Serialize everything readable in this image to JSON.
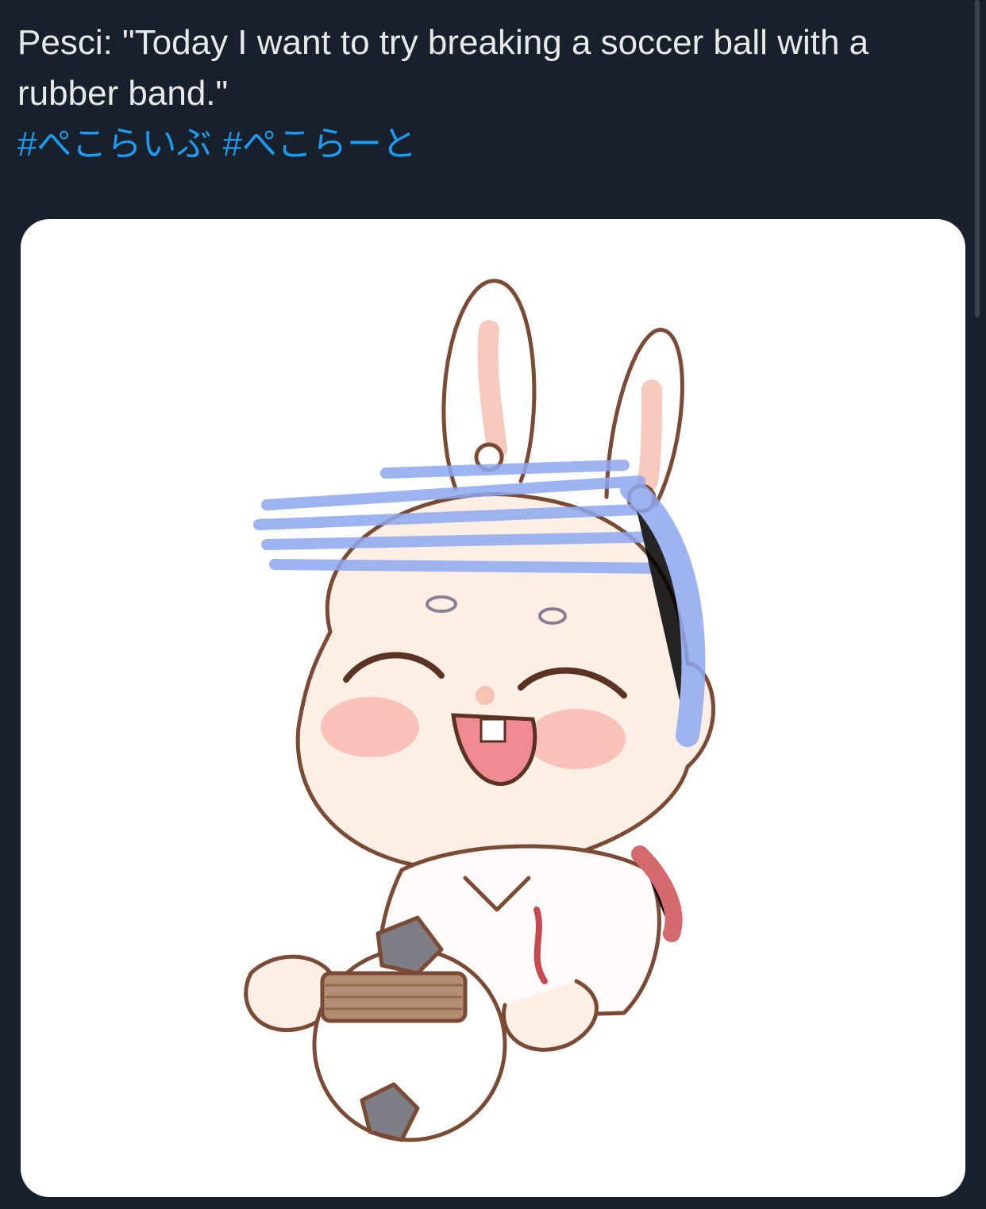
{
  "tweet": {
    "text": "Pesci: \"Today I want to try breaking a soccer ball with a rubber band.\"",
    "hashtags": [
      "#ぺこらいぶ",
      "#ぺこらーと"
    ]
  },
  "media": {
    "description_icon": "illustration-image"
  },
  "colors": {
    "background": "#17202b",
    "text": "#e7e9ea",
    "link": "#1d9bf0"
  }
}
